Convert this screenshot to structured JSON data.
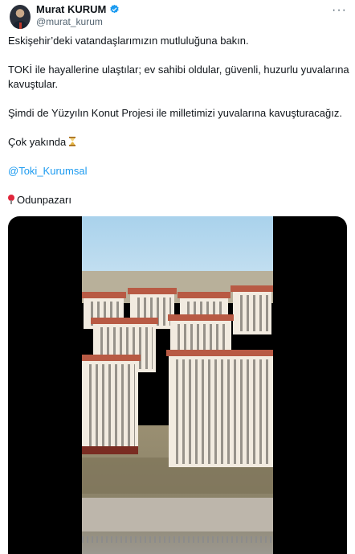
{
  "author": {
    "display_name": "Murat KURUM",
    "handle": "@murat_kurum",
    "verified_icon": "verified-badge-icon",
    "verified_color": "#1d9bf0"
  },
  "more_icon": "more-horizontal-icon",
  "more_glyph": "···",
  "tweet": {
    "line1": "Eskişehir’deki vatandaşlarımızın mutluluğuna bakın.",
    "line2a": "TOKİ ile hayallerine ulaştılar; ev sahibi oldular, güvenli, huzurlu yuvalarına",
    "line2b": "kavuştular.",
    "line3": "Şimdi de Yüzyılın Konut Projesi ile milletimizi yuvalarına kavuşturacağız.",
    "line4": "Çok yakında",
    "mention": "@Toki_Kurumsal",
    "location": "Odunpazarı",
    "location_icon": "round-pushpin-icon",
    "hourglass_icon": "hourglass-icon"
  },
  "media": {
    "type": "video",
    "accent_color": "#1d9bf0"
  }
}
